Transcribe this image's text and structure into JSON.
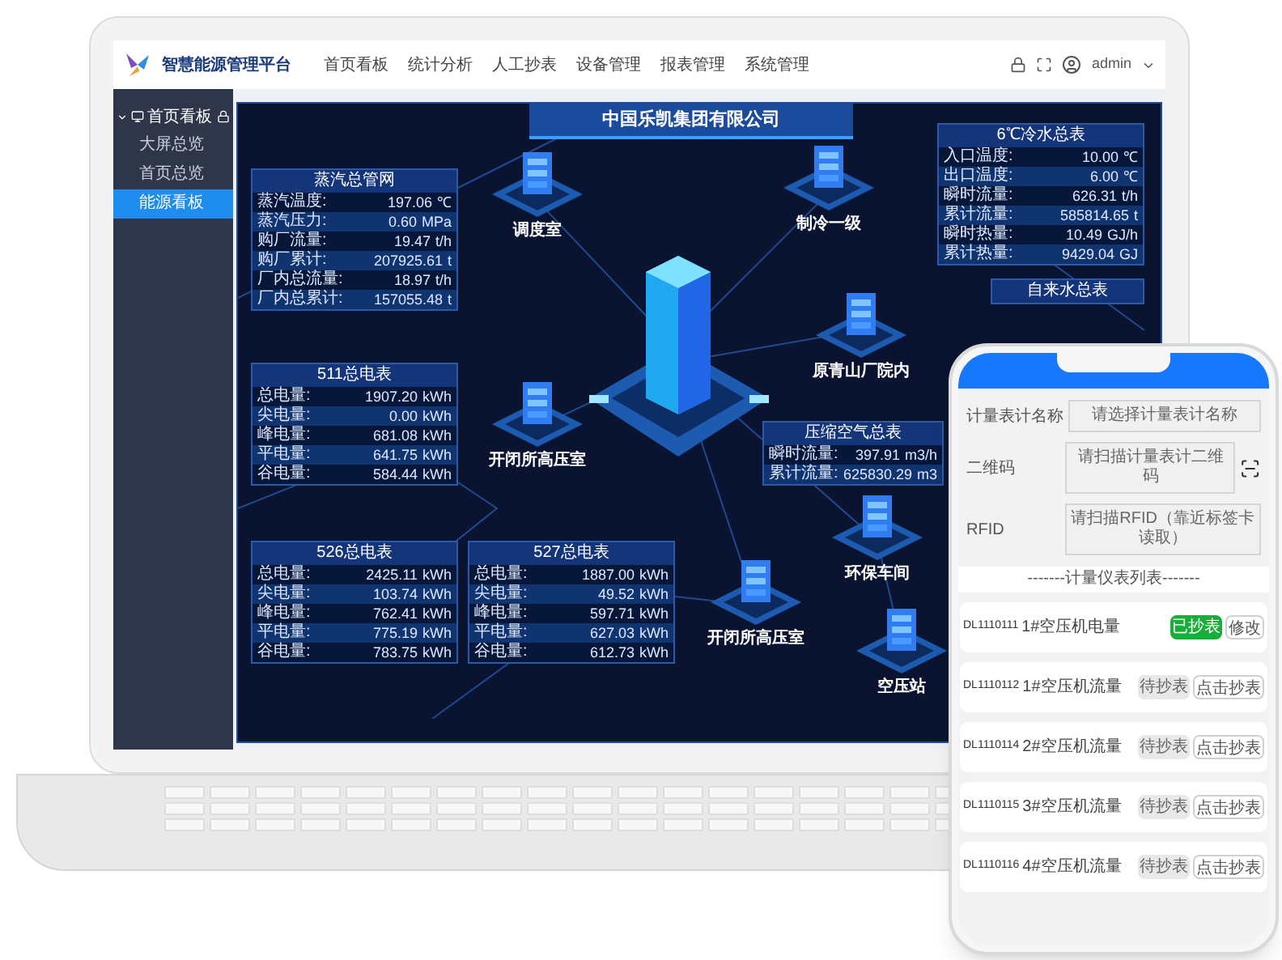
{
  "app": {
    "logo_text": "智慧能源管理平台",
    "nav": [
      "首页看板",
      "统计分析",
      "人工抄表",
      "设备管理",
      "报表管理",
      "系统管理"
    ],
    "user": "admin"
  },
  "sidebar": {
    "items": [
      {
        "label": "首页看板",
        "expanded": true,
        "children": [
          {
            "label": "大屏总览",
            "selected": false
          },
          {
            "label": "首页总览",
            "selected": false
          },
          {
            "label": "能源看板",
            "selected": true
          }
        ]
      }
    ]
  },
  "dashboard": {
    "title": "中国乐凯集团有限公司",
    "panels": [
      {
        "title": "蒸汽总管网",
        "rows": [
          {
            "label": "蒸汽温度:",
            "value": "197.06",
            "unit": "℃"
          },
          {
            "label": "蒸汽压力:",
            "value": "0.60",
            "unit": "MPa"
          },
          {
            "label": "购厂流量:",
            "value": "19.47",
            "unit": "t/h"
          },
          {
            "label": "购厂累计:",
            "value": "207925.61",
            "unit": "t"
          },
          {
            "label": "厂内总流量:",
            "value": "18.97",
            "unit": "t/h"
          },
          {
            "label": "厂内总累计:",
            "value": "157055.48",
            "unit": "t"
          }
        ]
      },
      {
        "title": "6℃冷水总表",
        "rows": [
          {
            "label": "入口温度:",
            "value": "10.00",
            "unit": "℃"
          },
          {
            "label": "出口温度:",
            "value": "6.00",
            "unit": "℃"
          },
          {
            "label": "瞬时流量:",
            "value": "626.31",
            "unit": "t/h"
          },
          {
            "label": "累计流量:",
            "value": "585814.65",
            "unit": "t"
          },
          {
            "label": "瞬时热量:",
            "value": "10.49",
            "unit": "GJ/h"
          },
          {
            "label": "累计热量:",
            "value": "9429.04",
            "unit": "GJ"
          }
        ]
      },
      {
        "title": "自来水总表"
      },
      {
        "title": "511总电表",
        "rows": [
          {
            "label": "总电量:",
            "value": "1907.20",
            "unit": "kWh"
          },
          {
            "label": "尖电量:",
            "value": "0.00",
            "unit": "kWh"
          },
          {
            "label": "峰电量:",
            "value": "681.08",
            "unit": "kWh"
          },
          {
            "label": "平电量:",
            "value": "641.75",
            "unit": "kWh"
          },
          {
            "label": "谷电量:",
            "value": "584.44",
            "unit": "kWh"
          }
        ]
      },
      {
        "title": "526总电表",
        "rows": [
          {
            "label": "总电量:",
            "value": "2425.11",
            "unit": "kWh"
          },
          {
            "label": "尖电量:",
            "value": "103.74",
            "unit": "kWh"
          },
          {
            "label": "峰电量:",
            "value": "762.41",
            "unit": "kWh"
          },
          {
            "label": "平电量:",
            "value": "775.19",
            "unit": "kWh"
          },
          {
            "label": "谷电量:",
            "value": "783.75",
            "unit": "kWh"
          }
        ]
      },
      {
        "title": "527总电表",
        "rows": [
          {
            "label": "总电量:",
            "value": "1887.00",
            "unit": "kWh"
          },
          {
            "label": "尖电量:",
            "value": "49.52",
            "unit": "kWh"
          },
          {
            "label": "峰电量:",
            "value": "597.71",
            "unit": "kWh"
          },
          {
            "label": "平电量:",
            "value": "627.03",
            "unit": "kWh"
          },
          {
            "label": "谷电量:",
            "value": "612.73",
            "unit": "kWh"
          }
        ]
      },
      {
        "title": "压缩空气总表",
        "rows": [
          {
            "label": "瞬时流量:",
            "value": "397.91",
            "unit": "m3/h"
          },
          {
            "label": "累计流量:",
            "value": "625830.29",
            "unit": "m3"
          }
        ]
      }
    ],
    "nodes": [
      {
        "label": "调度室"
      },
      {
        "label": "制冷一级"
      },
      {
        "label": "原青山厂院内"
      },
      {
        "label": "开闭所高压室"
      },
      {
        "label": "环保车间"
      },
      {
        "label": "开闭所高压室"
      },
      {
        "label": "空压站"
      }
    ]
  },
  "phone": {
    "fields": [
      {
        "label": "计量表计名称",
        "placeholder": "请选择计量表计名称",
        "scan_button": false
      },
      {
        "label": "二维码",
        "placeholder": "请扫描计量表计二维码",
        "scan_button": true
      },
      {
        "label": "RFID",
        "placeholder": "请扫描RFID（靠近标签卡读取）",
        "scan_button": false
      }
    ],
    "list_title": "-------计量仪表列表-------",
    "meters": [
      {
        "id": "DL1110111",
        "name": "1#空压机电量",
        "read": true,
        "status": "已抄表",
        "action": "修改"
      },
      {
        "id": "DL1110112",
        "name": "1#空压机流量",
        "read": false,
        "status": "待抄表",
        "action": "点击抄表"
      },
      {
        "id": "DL1110114",
        "name": "2#空压机流量",
        "read": false,
        "status": "待抄表",
        "action": "点击抄表"
      },
      {
        "id": "DL1110115",
        "name": "3#空压机流量",
        "read": false,
        "status": "待抄表",
        "action": "点击抄表"
      },
      {
        "id": "DL1110116",
        "name": "4#空压机流量",
        "read": false,
        "status": "待抄表",
        "action": "点击抄表"
      }
    ]
  }
}
